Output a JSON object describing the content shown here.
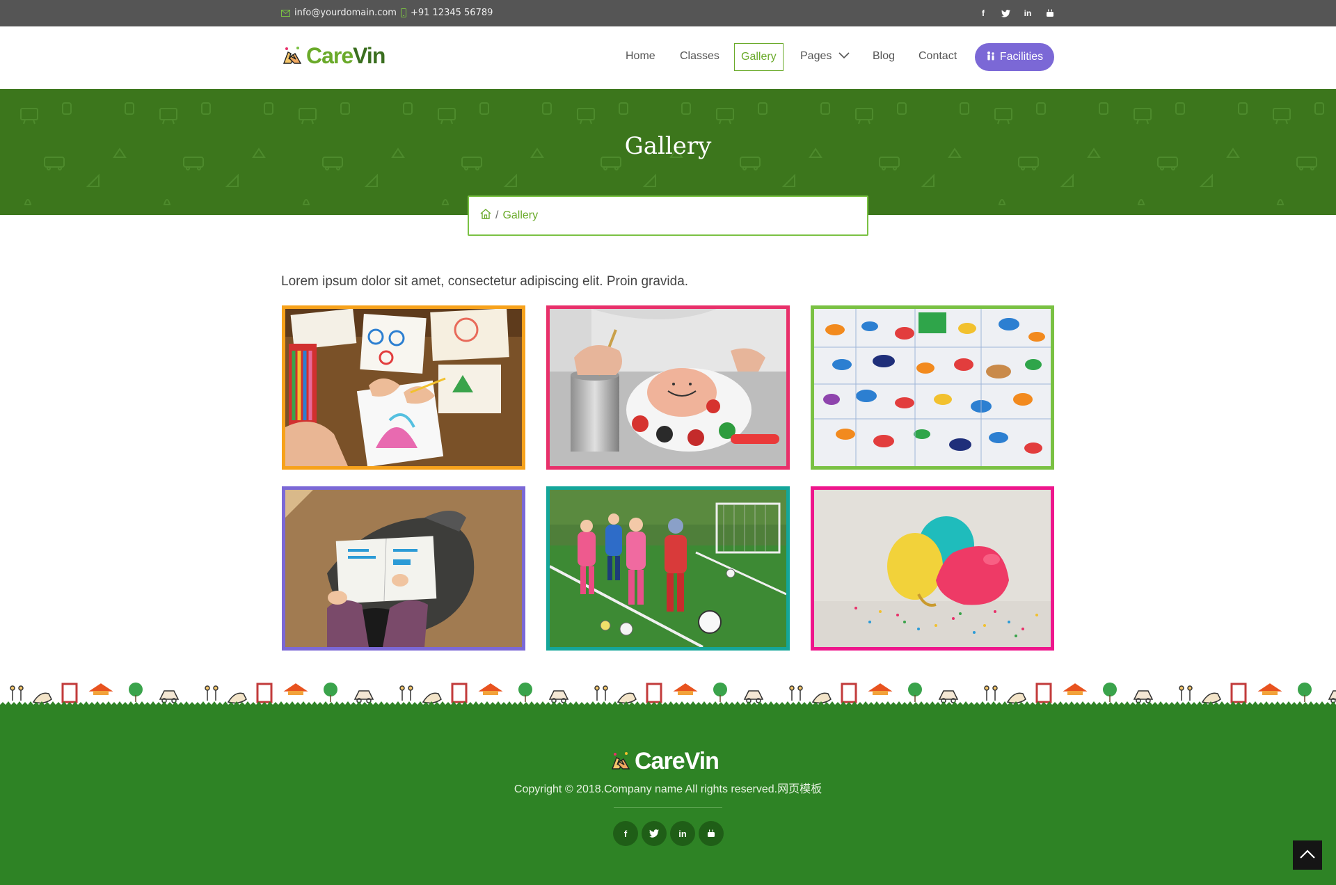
{
  "topbar": {
    "email": "info@yourdomain.com",
    "phone": "+91 12345 56789",
    "social_icons": [
      "facebook-icon",
      "twitter-icon",
      "linkedin-icon",
      "youtube-icon"
    ]
  },
  "brand": {
    "name_part1": "Care",
    "name_part2": "Vin"
  },
  "nav": {
    "home": "Home",
    "classes": "Classes",
    "gallery": "Gallery",
    "pages": "Pages",
    "blog": "Blog",
    "contact": "Contact",
    "facilities": "Facilities"
  },
  "banner": {
    "title": "Gallery"
  },
  "breadcrumb": {
    "separator": "/",
    "current": "Gallery"
  },
  "intro": "Lorem ipsum dolor sit amet, consectetur adipiscing elit. Proin gravida.",
  "gallery": {
    "items": [
      {
        "subject": "child-coloring-drawings",
        "border": "#f7a21b"
      },
      {
        "subject": "child-painting-pot",
        "border": "#e8306a"
      },
      {
        "subject": "fish-drawings-wall",
        "border": "#7ac143"
      },
      {
        "subject": "child-reading-book",
        "border": "#7b68d6"
      },
      {
        "subject": "children-playing-football",
        "border": "#14a69a"
      },
      {
        "subject": "balloons-confetti",
        "border": "#ee168c"
      }
    ]
  },
  "footer": {
    "brand": "CareVin",
    "copyright": "Copyright © 2018.Company name All rights reserved.网页模板",
    "social_icons": [
      "facebook-icon",
      "twitter-icon",
      "linkedin-icon",
      "youtube-icon"
    ]
  },
  "colors": {
    "topbar": "#555555",
    "banner": "#3c761c",
    "accent": "#6aaa2a",
    "facilities": "#7b68d6",
    "footer": "#2e8325"
  }
}
